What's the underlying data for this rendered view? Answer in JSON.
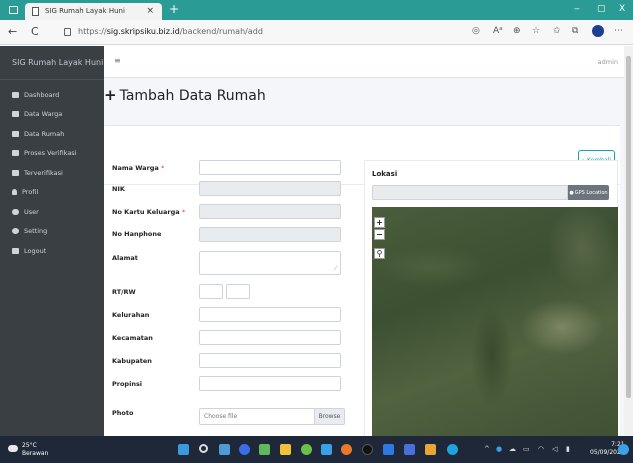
{
  "browser": {
    "tab_title": "SIG Rumah Layak Huni",
    "tab_close": "×",
    "new_tab": "+",
    "url_prefix": "https://",
    "url_domain": "sig.skripsiku.biz.id",
    "url_path": "/backend/rumah/add",
    "back": "←",
    "refresh": "C",
    "win_min": "‒",
    "win_max": "▢",
    "win_close": "X"
  },
  "sidebar": {
    "brand": "SIG Rumah Layak Huni",
    "items": [
      {
        "label": "Dashboard",
        "icon": "dashboard-icon"
      },
      {
        "label": "Data Warga",
        "icon": "list-icon"
      },
      {
        "label": "Data Rumah",
        "icon": "list-icon"
      },
      {
        "label": "Proses Verifikasi",
        "icon": "check-square-icon"
      },
      {
        "label": "Terverifikasi",
        "icon": "check-square-icon"
      },
      {
        "label": "Profil",
        "icon": "user-icon"
      },
      {
        "label": "User",
        "icon": "users-icon"
      },
      {
        "label": "Setting",
        "icon": "gear-icon"
      },
      {
        "label": "Logout",
        "icon": "logout-icon"
      }
    ]
  },
  "topnav": {
    "menu_glyph": "≡",
    "user": "admin"
  },
  "page": {
    "title": "Tambah Data Rumah",
    "title_icon": "+",
    "back_label": "←Kembali"
  },
  "form": {
    "required_mark": "*",
    "fields": {
      "nama_warga": "Nama Warga",
      "nik": "NIK",
      "no_kk": "No Kartu Keluarga",
      "no_hp": "No Hanphone",
      "alamat": "Alamat",
      "rtrw": "RT/RW",
      "kelurahan": "Kelurahan",
      "kecamatan": "Kecamatan",
      "kabupaten": "Kabupaten",
      "propinsi": "Propinsi",
      "photo": "Photo"
    },
    "file_placeholder": "Choose file",
    "browse_label": "Browse"
  },
  "location": {
    "title": "Lokasi",
    "gps_label": "GPS Location",
    "zoom_in": "+",
    "zoom_out": "−",
    "search_glyph": "⚲"
  },
  "taskbar": {
    "temperature": "25°C",
    "weather": "Berawan",
    "time": "7:21",
    "date": "05/09/2022"
  }
}
